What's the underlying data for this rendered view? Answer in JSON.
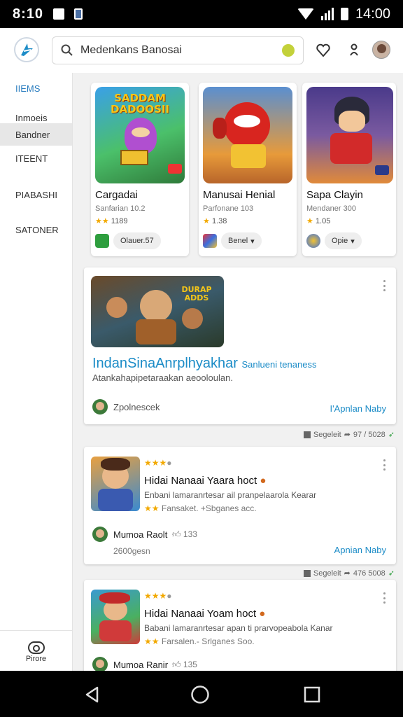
{
  "status_bar": {
    "time": "8:10",
    "clock": "14:00"
  },
  "search": {
    "value": "Medenkans Banosai"
  },
  "sidebar": {
    "items": [
      {
        "label": "IIEMS"
      },
      {
        "label": "Inmoeis"
      },
      {
        "label": "Bandner"
      },
      {
        "label": "ITEENT"
      },
      {
        "label": "PIABASHI"
      },
      {
        "label": "SATONER"
      }
    ],
    "photo_label": "Pirore"
  },
  "apps": [
    {
      "art_text": "SADDAM DADOOSII",
      "name": "Cargadai",
      "sub": "Sanfarian 10.2",
      "rating": "1189",
      "chip": "Olauer.57"
    },
    {
      "art_text": "",
      "name": "Manusai Henial",
      "sub": "Parfonane 103",
      "rating": "1.38",
      "chip": "Benel"
    },
    {
      "art_text": "",
      "name": "Sapa Clayin",
      "sub": "Mendaner 300",
      "rating": "1.05",
      "chip": "Opie"
    }
  ],
  "feature": {
    "art_text": "DURAP ADDS",
    "title": "IndanSinaAnrplhyakhar",
    "title_suffix": "Sanlueni tenaness",
    "desc": "Atankahapipetaraakan aeooloulan.",
    "author": "Zpolnescek",
    "action": "I'Apnlan Naby",
    "meta_label": "Segeleit",
    "meta_value": "97 / 5028"
  },
  "list": [
    {
      "title": "Hidai Nanaai Yaara hoct",
      "desc": "Enbani lamaranrtesar ail pranpelaarola Kearar",
      "stats": "Fansaket. +Sbganes acc.",
      "author": "Mumoa Raolt",
      "likes": "133",
      "count": "2600gesn",
      "action": "Apnian Naby",
      "meta_label": "Segeleit",
      "meta_value": "476 5008"
    },
    {
      "title": "Hidai Nanaai Yoam hoct",
      "desc": "Babani lamaranrtesar apan ti prarvopeabola Kanar",
      "stats": "Farsalen.- Srlganes Soo.",
      "author": "Mumoa Ranir",
      "likes": "135"
    }
  ],
  "colors": {
    "accent": "#1c8cc7",
    "star": "#f2a900",
    "nav": "#000000"
  }
}
